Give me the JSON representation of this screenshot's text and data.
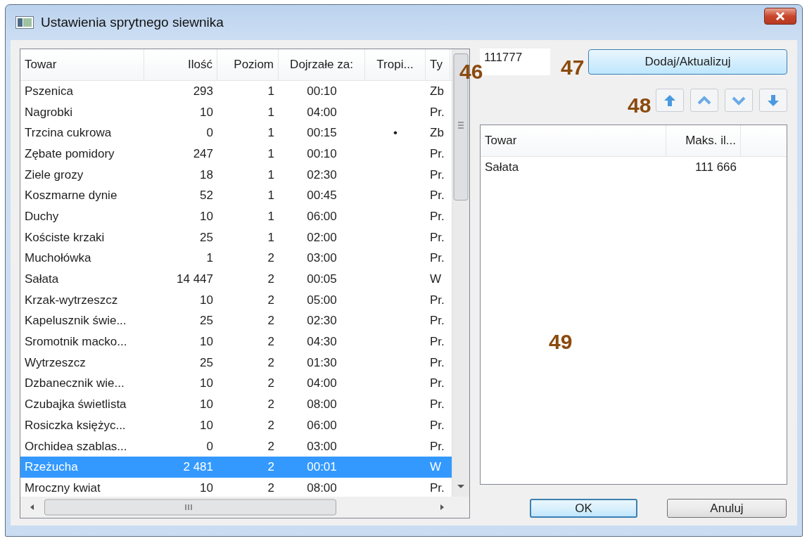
{
  "window": {
    "title": "Ustawienia sprytnego siewnika"
  },
  "items_table": {
    "columns": [
      "Towar",
      "Ilość",
      "Poziom",
      "Dojrzałe za:",
      "Tropi...",
      "Ty"
    ],
    "rows": [
      {
        "name": "Pszenica",
        "qty": "293",
        "poziom": "1",
        "ready": "00:10",
        "typ": "Zb",
        "selected": false
      },
      {
        "name": "Nagrobki",
        "qty": "10",
        "poziom": "1",
        "ready": "04:00",
        "typ": "Pr.",
        "selected": false
      },
      {
        "name": "Trzcina cukrowa",
        "qty": "0",
        "poziom": "1",
        "ready": "00:15",
        "tropi": "•",
        "typ": "Zb",
        "selected": false
      },
      {
        "name": "Zębate pomidory",
        "qty": "247",
        "poziom": "1",
        "ready": "00:10",
        "typ": "Pr.",
        "selected": false
      },
      {
        "name": "Ziele grozy",
        "qty": "18",
        "poziom": "1",
        "ready": "02:30",
        "typ": "Pr.",
        "selected": false
      },
      {
        "name": "Koszmarne dynie",
        "qty": "52",
        "poziom": "1",
        "ready": "00:45",
        "typ": "Pr.",
        "selected": false
      },
      {
        "name": "Duchy",
        "qty": "10",
        "poziom": "1",
        "ready": "06:00",
        "typ": "Pr.",
        "selected": false
      },
      {
        "name": "Kościste krzaki",
        "qty": "25",
        "poziom": "1",
        "ready": "02:00",
        "typ": "Pr.",
        "selected": false
      },
      {
        "name": "Muchołówka",
        "qty": "1",
        "poziom": "2",
        "ready": "03:00",
        "typ": "Pr.",
        "selected": false
      },
      {
        "name": "Sałata",
        "qty": "14 447",
        "poziom": "2",
        "ready": "00:05",
        "typ": "W",
        "selected": false
      },
      {
        "name": "Krzak-wytrzeszcz",
        "qty": "10",
        "poziom": "2",
        "ready": "05:00",
        "typ": "Pr.",
        "selected": false
      },
      {
        "name": "Kapelusznik świe...",
        "qty": "25",
        "poziom": "2",
        "ready": "02:30",
        "typ": "Pr.",
        "selected": false
      },
      {
        "name": "Sromotnik macko...",
        "qty": "10",
        "poziom": "2",
        "ready": "04:30",
        "typ": "Pr.",
        "selected": false
      },
      {
        "name": "Wytrzeszcz",
        "qty": "25",
        "poziom": "2",
        "ready": "01:30",
        "typ": "Pr.",
        "selected": false
      },
      {
        "name": "Dzbanecznik wie...",
        "qty": "10",
        "poziom": "2",
        "ready": "04:00",
        "typ": "Pr.",
        "selected": false
      },
      {
        "name": "Czubajka świetlista",
        "qty": "10",
        "poziom": "2",
        "ready": "08:00",
        "typ": "Pr.",
        "selected": false
      },
      {
        "name": "Rosiczka księżyc...",
        "qty": "10",
        "poziom": "2",
        "ready": "06:00",
        "typ": "Pr.",
        "selected": false
      },
      {
        "name": "Orchidea szablas...",
        "qty": "0",
        "poziom": "2",
        "ready": "03:00",
        "typ": "Pr.",
        "selected": false
      },
      {
        "name": "Rzeżucha",
        "qty": "2 481",
        "poziom": "2",
        "ready": "00:01",
        "typ": "W",
        "selected": true
      },
      {
        "name": "Mroczny kwiat",
        "qty": "10",
        "poziom": "2",
        "ready": "08:00",
        "typ": "Pr.",
        "selected": false
      }
    ]
  },
  "amount_field": {
    "value": "111777"
  },
  "add_button": {
    "label": "Dodaj/Aktualizuj"
  },
  "limits_table": {
    "columns": [
      "Towar",
      "Maks. il..."
    ],
    "rows": [
      {
        "name": "Sałata",
        "max": "111 666",
        "selected": false
      }
    ]
  },
  "buttons": [
    {
      "label": "OK",
      "default": true
    },
    {
      "label": "Anuluj",
      "default": false
    }
  ],
  "annotations": [
    {
      "label": "46"
    },
    {
      "label": "47"
    },
    {
      "label": "48"
    },
    {
      "label": "49"
    }
  ]
}
